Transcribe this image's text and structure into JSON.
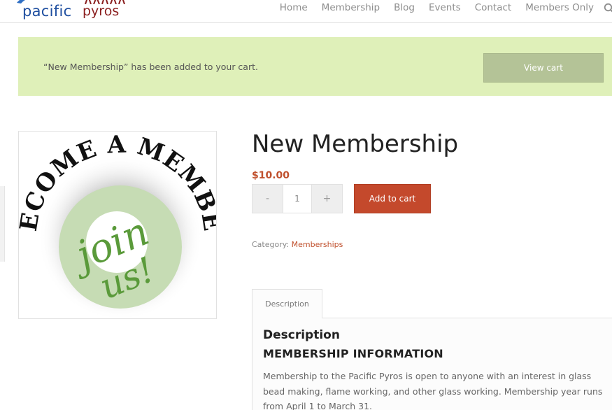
{
  "header": {
    "logo": {
      "word1": "pacific",
      "word2": "pyros"
    },
    "nav": [
      {
        "label": "Home"
      },
      {
        "label": "Membership"
      },
      {
        "label": "Blog"
      },
      {
        "label": "Events"
      },
      {
        "label": "Contact"
      },
      {
        "label": "Members Only"
      }
    ],
    "search_icon": "search-icon"
  },
  "notice": {
    "message": "“New Membership” has been added to your cart.",
    "button_label": "View cart"
  },
  "product": {
    "image_text": {
      "arc_text": "BECOME A MEMBER",
      "script_line1": "join",
      "script_line2": "us!"
    },
    "title": "New Membership",
    "price": "$10.00",
    "quantity": {
      "minus_label": "-",
      "value": "1",
      "plus_label": "+"
    },
    "add_to_cart_label": "Add to cart",
    "category_label": "Category:",
    "category_value": "Memberships"
  },
  "tabs": {
    "items": [
      {
        "label": "Description"
      }
    ]
  },
  "description": {
    "heading": "Description",
    "subheading": "MEMBERSHIP INFORMATION",
    "body": "Membership to the Pacific Pyros is open to anyone with an interest in glass bead making, flame working, and other glass working. Membership year runs from April 1 to March 31."
  },
  "colors": {
    "accent": "#c4492c",
    "notice_bg": "#dff0b9",
    "view_cart_bg": "#b4c397",
    "logo_blue": "#1f4fa0",
    "logo_red": "#8a1e1e",
    "badge_green": "#5a9a3a"
  }
}
